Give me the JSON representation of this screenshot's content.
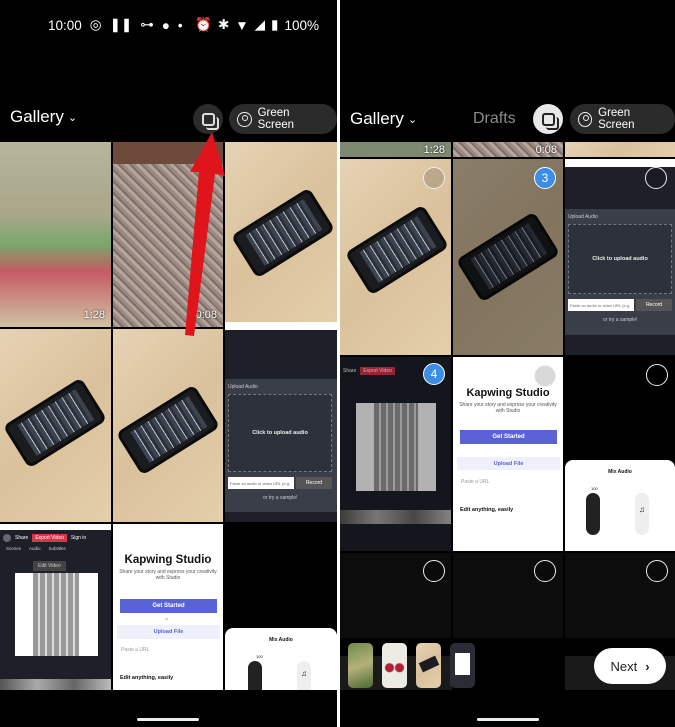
{
  "status_bar": {
    "time": "10:00",
    "battery": "100%",
    "icons": [
      "whatsapp-icon",
      "pause-icon",
      "voicemail-icon",
      "phone-icon",
      "dot-icon",
      "alarm-icon",
      "bluetooth-icon",
      "wifi-icon",
      "signal-icon",
      "battery-icon"
    ]
  },
  "left": {
    "header": {
      "title": "Gallery",
      "multi_select_icon": "stack-icon",
      "green_screen": "Green Screen"
    },
    "durations": [
      "1:28",
      "0:08"
    ],
    "annotation": {
      "type": "red-arrow",
      "color": "#e0141b"
    }
  },
  "right": {
    "header": {
      "title": "Gallery",
      "drafts": "Drafts",
      "green_screen": "Green Screen"
    },
    "durations": [
      "1:28",
      "0:08"
    ],
    "selection_numbers": [
      "3",
      "4"
    ],
    "next_label": "Next",
    "accent": "#3a8ee6"
  },
  "kapwing": {
    "upload_audio_title": "Upload Audio",
    "click_upload": "Click to upload audio",
    "paste_placeholder": "Paste an audio or video URL (e.g.",
    "record": "Record",
    "try_sample": "or try a sample!",
    "share": "Share",
    "export": "Export Video",
    "sign_in": "Sign in",
    "tabs": [
      "Scenes",
      "Audio",
      "Subtitles"
    ],
    "edit_video": "Edit Video",
    "studio_title": "Kapwing Studio",
    "studio_sub": "Share your story and express your creativity with Studio",
    "get_started": "Get Started",
    "or": "or",
    "upload_file": "Upload File",
    "paste_url": "Paste a URL",
    "edit_easily": "Edit anything, easily",
    "mix_audio": "Mix Audio",
    "mix_value": "100"
  }
}
